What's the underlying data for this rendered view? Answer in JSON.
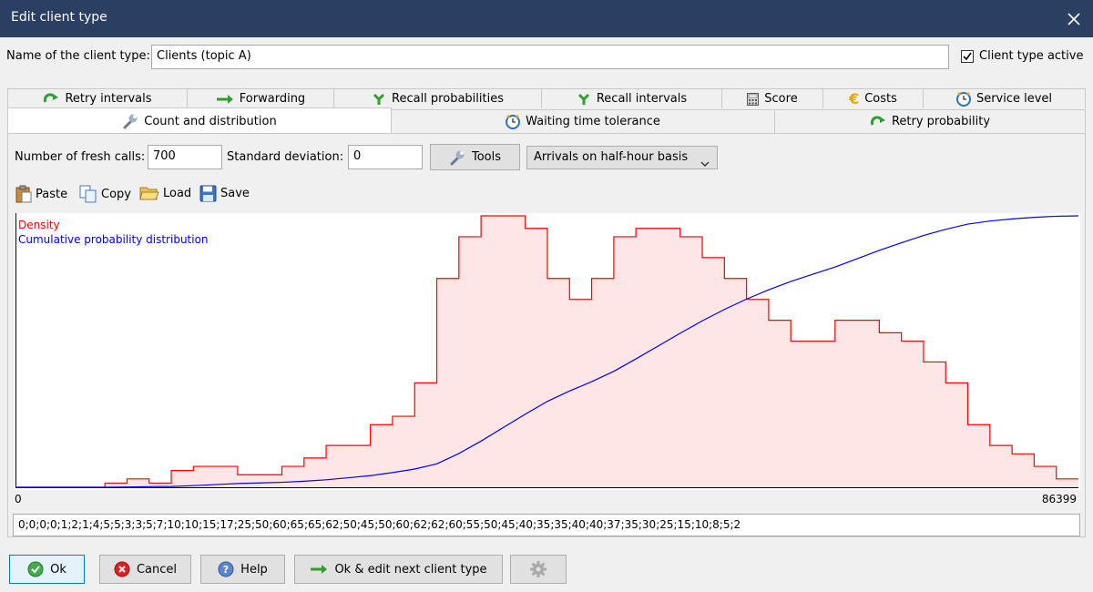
{
  "window": {
    "title": "Edit client type"
  },
  "name_label": "Name of the client type:",
  "name_value": "Clients (topic A)",
  "active_label": "Client type active",
  "active_checked": true,
  "tabs_row1": [
    "Retry intervals",
    "Forwarding",
    "Recall probabilities",
    "Recall intervals",
    "Score",
    "Costs",
    "Service level"
  ],
  "tabs_row2": [
    "Count and distribution",
    "Waiting time tolerance",
    "Retry probability"
  ],
  "controls": {
    "fresh_calls_label": "Number of fresh calls:",
    "fresh_calls_value": "700",
    "std_dev_label": "Standard deviation:",
    "std_dev_value": "0",
    "tools_label": "Tools",
    "arrivals_selected": "Arrivals on half-hour basis"
  },
  "toolbar": {
    "paste": "Paste",
    "copy": "Copy",
    "load": "Load",
    "save": "Save"
  },
  "chart_data": {
    "type": "area",
    "series": [
      {
        "name": "Density",
        "color": "#ff0000"
      },
      {
        "name": "Cumulative probability distribution",
        "color": "#0000ff"
      }
    ],
    "x_min_label": "0",
    "x_max_label": "86399",
    "values": [
      0,
      0,
      0,
      0,
      1,
      2,
      1,
      4,
      5,
      5,
      3,
      3,
      5,
      7,
      10,
      10,
      15,
      17,
      25,
      50,
      60,
      65,
      65,
      62,
      50,
      45,
      50,
      60,
      62,
      62,
      60,
      55,
      50,
      45,
      40,
      35,
      35,
      40,
      40,
      37,
      35,
      30,
      25,
      15,
      10,
      8,
      5,
      2
    ]
  },
  "values_text": "0;0;0;0;1;2;1;4;5;5;3;3;5;7;10;10;15;17;25;50;60;65;65;62;50;45;50;60;62;62;60;55;50;45;40;35;35;40;40;37;35;30;25;15;10;8;5;2",
  "buttons": {
    "ok": "Ok",
    "cancel": "Cancel",
    "help": "Help",
    "ok_next": "Ok & edit next client type"
  }
}
